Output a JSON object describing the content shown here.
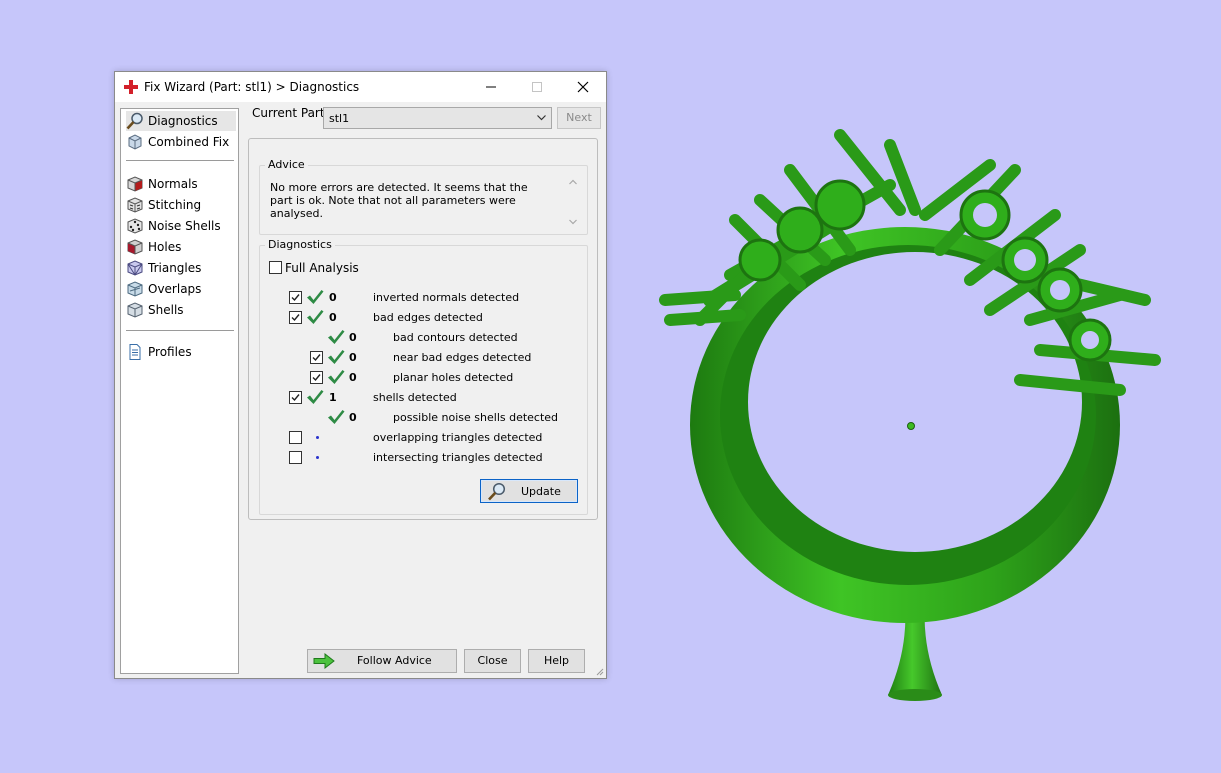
{
  "window": {
    "title": "Fix Wizard (Part: stl1) > Diagnostics"
  },
  "nav": {
    "items": [
      {
        "label": "Diagnostics",
        "icon": "magnifier-icon",
        "selected": true
      },
      {
        "label": "Combined Fix",
        "icon": "combined-fix-cube-icon"
      },
      {
        "label": "Normals",
        "icon": "normals-cube-icon"
      },
      {
        "label": "Stitching",
        "icon": "stitching-cube-icon"
      },
      {
        "label": "Noise Shells",
        "icon": "noise-shells-cube-icon"
      },
      {
        "label": "Holes",
        "icon": "holes-cube-icon"
      },
      {
        "label": "Triangles",
        "icon": "triangles-cube-icon"
      },
      {
        "label": "Overlaps",
        "icon": "overlaps-cube-icon"
      },
      {
        "label": "Shells",
        "icon": "shells-cube-icon"
      },
      {
        "label": "Profiles",
        "icon": "profiles-document-icon"
      }
    ]
  },
  "header": {
    "current_part_label": "Current Part:",
    "current_part_value": "stl1",
    "next_label": "Next"
  },
  "advice": {
    "title": "Advice",
    "text": "No more errors are detected. It seems that the part is ok. Note that not all parameters were analysed."
  },
  "diagnostics": {
    "title": "Diagnostics",
    "full_analysis_label": "Full Analysis",
    "full_analysis_checked": false,
    "rows": [
      {
        "checkbox": true,
        "checked": true,
        "status": "check",
        "count": "0",
        "label": "inverted normals detected",
        "indent": 0
      },
      {
        "checkbox": true,
        "checked": true,
        "status": "check",
        "count": "0",
        "label": "bad edges detected",
        "indent": 0
      },
      {
        "checkbox": false,
        "checked": false,
        "status": "check",
        "count": "0",
        "label": "bad contours detected",
        "indent": 1
      },
      {
        "checkbox": true,
        "checked": true,
        "status": "check",
        "count": "0",
        "label": "near bad edges detected",
        "indent": 1
      },
      {
        "checkbox": true,
        "checked": true,
        "status": "check",
        "count": "0",
        "label": "planar holes detected",
        "indent": 1
      },
      {
        "checkbox": true,
        "checked": true,
        "status": "check",
        "count": "1",
        "label": "shells detected",
        "indent": 0
      },
      {
        "checkbox": false,
        "checked": false,
        "status": "check",
        "count": "0",
        "label": "possible noise shells detected",
        "indent": 1
      },
      {
        "checkbox": true,
        "checked": false,
        "status": "dot",
        "count": "",
        "label": "overlapping triangles detected",
        "indent": 0
      },
      {
        "checkbox": true,
        "checked": false,
        "status": "dot",
        "count": "",
        "label": "intersecting triangles detected",
        "indent": 0
      }
    ],
    "update_label": "Update"
  },
  "buttons": {
    "follow_advice": "Follow Advice",
    "close": "Close",
    "help": "Help"
  },
  "colors": {
    "desktop_background": "#c6c6fa",
    "model_green": "#3dbb21",
    "check_green": "#2e8b45",
    "dot_blue": "#2a33cc"
  }
}
